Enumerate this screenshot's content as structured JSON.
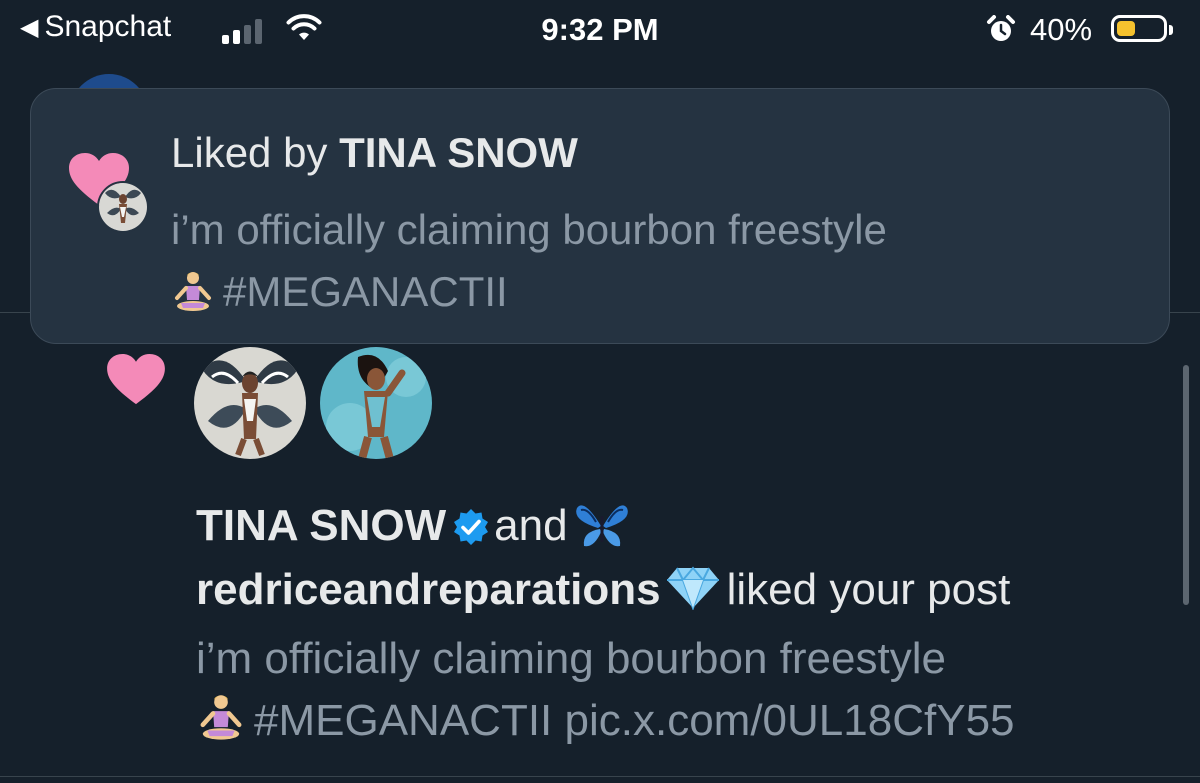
{
  "status_bar": {
    "back_app": "Snapchat",
    "time": "9:32 PM",
    "battery_percent": "40%",
    "battery_level": 0.4,
    "signal_bars_active": 2,
    "signal_bars_total": 4
  },
  "toast": {
    "title_prefix": "Liked by",
    "title_name": "TINA SNOW",
    "body_text": "i’m officially claiming bourbon freestyle",
    "body_hashtag": "#MEGANACTII"
  },
  "notification": {
    "user1": "TINA SNOW",
    "conjunction": "and",
    "user2": "redriceandreparations",
    "action": "liked your post",
    "post_text": "i’m officially claiming bourbon freestyle",
    "post_hashtag": "#MEGANACTII",
    "post_link": "pic.x.com/0UL18CfY55"
  },
  "colors": {
    "background": "#15202b",
    "toast_bg": "#253341",
    "heart": "#f48ab8",
    "verified": "#1d9bf0",
    "muted_text": "#8b98a5"
  }
}
